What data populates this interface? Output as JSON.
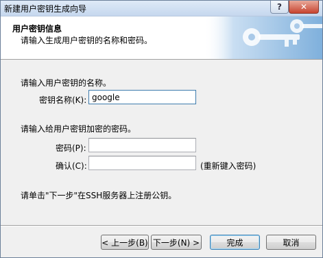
{
  "window": {
    "title": "新建用户密钥生成向导",
    "help_label": "?",
    "close_label": "✕"
  },
  "header": {
    "title": "用户密钥信息",
    "subtitle": "请输入生成用户密钥的名称和密码。"
  },
  "name_section": {
    "prompt": "请输入用户密钥的名称。",
    "label": "密钥名称(K):",
    "value": "google"
  },
  "password_section": {
    "prompt": "请输入给用户密钥加密的密码。",
    "password_label": "密码(P):",
    "password_value": "",
    "confirm_label": "确认(C):",
    "confirm_value": "",
    "confirm_hint": "(重新键入密码)"
  },
  "note": "请单击\"下一步\"在SSH服务器上注册公钥。",
  "buttons": {
    "back": "< 上一步(B)",
    "next": "下一步(N) >",
    "finish": "完成",
    "cancel": "取消"
  },
  "colors": {
    "title_gradient_top": "#dfeaf7",
    "title_gradient_bottom": "#c5d7ee",
    "banner_blue": "#8fb9de",
    "close_red": "#c7432f"
  },
  "icons": {
    "banner": "keys-icon"
  }
}
